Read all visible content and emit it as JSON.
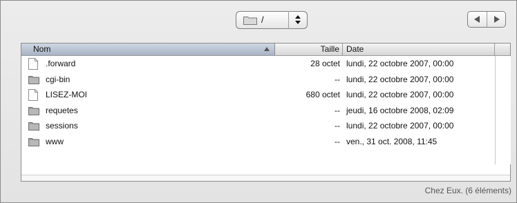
{
  "toolbar": {
    "path_label": "/",
    "back_icon": "chevron-left-icon",
    "forward_icon": "chevron-right-icon"
  },
  "columns": {
    "name": "Nom",
    "size": "Taille",
    "date": "Date"
  },
  "files": [
    {
      "name": ".forward",
      "size": "28 octet",
      "date": "lundi, 22 octobre 2007, 00:00",
      "kind": "file"
    },
    {
      "name": "cgi-bin",
      "size": "--",
      "date": "lundi, 22 octobre 2007, 00:00",
      "kind": "folder"
    },
    {
      "name": "LISEZ-MOI",
      "size": "680 octet",
      "date": "lundi, 22 octobre 2007, 00:00",
      "kind": "file"
    },
    {
      "name": "requetes",
      "size": "--",
      "date": "jeudi, 16 octobre 2008, 02:09",
      "kind": "folder"
    },
    {
      "name": "sessions",
      "size": "--",
      "date": "lundi, 22 octobre 2007, 00:00",
      "kind": "folder"
    },
    {
      "name": "www",
      "size": "--",
      "date": "ven., 31 oct. 2008, 11:45",
      "kind": "folder"
    }
  ],
  "status": "Chez Eux. (6 éléments)",
  "colors": {
    "header_selected": "#a7b3c5",
    "folder": "#9a9a9a"
  }
}
